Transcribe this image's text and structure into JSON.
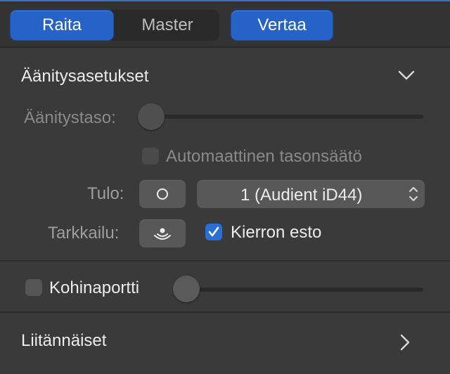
{
  "header": {
    "tab_track": "Raita",
    "tab_master": "Master",
    "compare_button": "Vertaa"
  },
  "recording": {
    "section_title": "Äänitysasetukset",
    "level_label": "Äänitystaso:",
    "level_value": 0,
    "auto_level_label": "Automaattinen tasonsäätö",
    "auto_level_checked": false,
    "input_label": "Tulo:",
    "input_select_value": "1  (Audient iD44)",
    "monitor_label": "Tarkkailu:",
    "feedback_protection_label": "Kierron esto",
    "feedback_protection_checked": true
  },
  "noise_gate": {
    "label": "Kohinaportti",
    "checked": false,
    "level_value": 0
  },
  "plugins": {
    "section_title": "Liitännäiset"
  },
  "colors": {
    "accent": "#2563c8",
    "background": "#3a3a3a"
  }
}
